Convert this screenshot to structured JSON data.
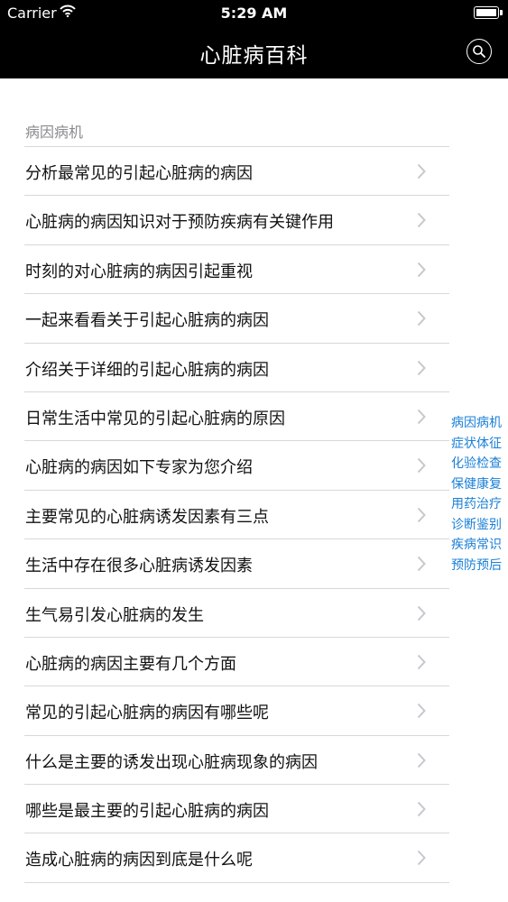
{
  "status_bar": {
    "carrier": "Carrier",
    "time": "5:29 AM",
    "icons": [
      "wifi-icon",
      "battery-icon"
    ]
  },
  "nav": {
    "title": "心脏病百科",
    "search_icon": "search-icon"
  },
  "section": {
    "header": "病因病机",
    "items": [
      "分析最常见的引起心脏病的病因",
      "心脏病的病因知识对于预防疾病有关键作用",
      "时刻的对心脏病的病因引起重视",
      "一起来看看关于引起心脏病的病因",
      "介绍关于详细的引起心脏病的病因",
      "日常生活中常见的引起心脏病的原因",
      "心脏病的病因如下专家为您介绍",
      "主要常见的心脏病诱发因素有三点",
      "生活中存在很多心脏病诱发因素",
      "生气易引发心脏病的发生",
      "心脏病的病因主要有几个方面",
      "常见的引起心脏病的病因有哪些呢",
      "什么是主要的诱发出现心脏病现象的病因",
      "哪些是最主要的引起心脏病的病因",
      "造成心脏病的病因到底是什么呢"
    ]
  },
  "section_index": [
    "病因病机",
    "症状体征",
    "化验检查",
    "保健康复",
    "用药治疗",
    "诊断鉴别",
    "疾病常识",
    "预防预后"
  ],
  "colors": {
    "nav_bg": "#000000",
    "index_text": "#1a7fd6",
    "separator": "#d8d8dc",
    "chevron": "#c7c7cc"
  }
}
